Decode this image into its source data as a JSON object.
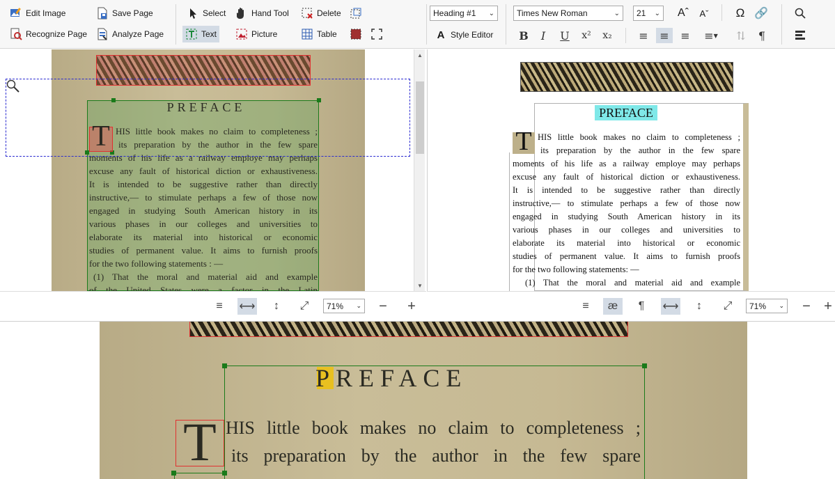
{
  "toolbar": {
    "edit_image": "Edit Image",
    "recognize_page": "Recognize Page",
    "save_page": "Save Page",
    "analyze_page": "Analyze Page",
    "select": "Select",
    "hand_tool": "Hand Tool",
    "delete": "Delete",
    "text": "Text",
    "picture": "Picture",
    "table": "Table"
  },
  "format": {
    "style_value": "Heading #1",
    "style_editor": "Style Editor",
    "font_value": "Times New Roman",
    "size_value": "21",
    "bold": "B",
    "italic": "I",
    "underline": "U"
  },
  "left_zoom": {
    "value": "71%"
  },
  "right_zoom": {
    "value": "71%"
  },
  "scan": {
    "heading": "PREFACE",
    "dropcap": "T",
    "lines": [
      "HIS little book makes no claim to completeness ;",
      "its preparation by the author in the few spare",
      "moments of his life as a railway employe may perhaps",
      "excuse any fault of historical diction or exhaustiveness.",
      "It is intended to be suggestive rather than directly",
      "instructive,— to stimulate perhaps a few of those now",
      "engaged in studying South American history in its",
      "various phases in our colleges and universities to",
      "elaborate its material into historical or economic",
      "studies of permanent value.   It aims to furnish proofs",
      "for the two following statements : —",
      "(1) That the moral and material aid and example",
      "of the United States were a factor in the Latin"
    ]
  },
  "ocr": {
    "heading": "PREFACE",
    "dropcap": "T",
    "lines": [
      "HIS little book makes no claim to completeness ;",
      "its preparation by the author in the few spare",
      "moments of his life as a railway employe may perhaps",
      "excuse any fault of historical diction or exhaustiveness.",
      "It is intended to be suggestive rather than directly",
      "instructive,— to stimulate perhaps a few of those now",
      "engaged in studying South American history in its",
      "various phases in our colleges and universities to",
      "elaborate its material into historical or economic",
      "studies of permanent value. It aims to furnish proofs",
      "for the two following statements: —",
      "(1) That the moral and material aid and example"
    ]
  },
  "zoomed": {
    "heading": "PREFACE",
    "dropcap": "T",
    "lines": [
      "HIS little book makes no claim to completeness ;",
      "its preparation by the author in the few spare"
    ]
  },
  "colors": {
    "text_block": "#1a7a1a",
    "picture_block": "#e03030",
    "selection": "#2a2ad0",
    "ocr_highlight": "#7fe8e8",
    "char_highlight": "#e8c020",
    "paper": "#c6b993"
  }
}
